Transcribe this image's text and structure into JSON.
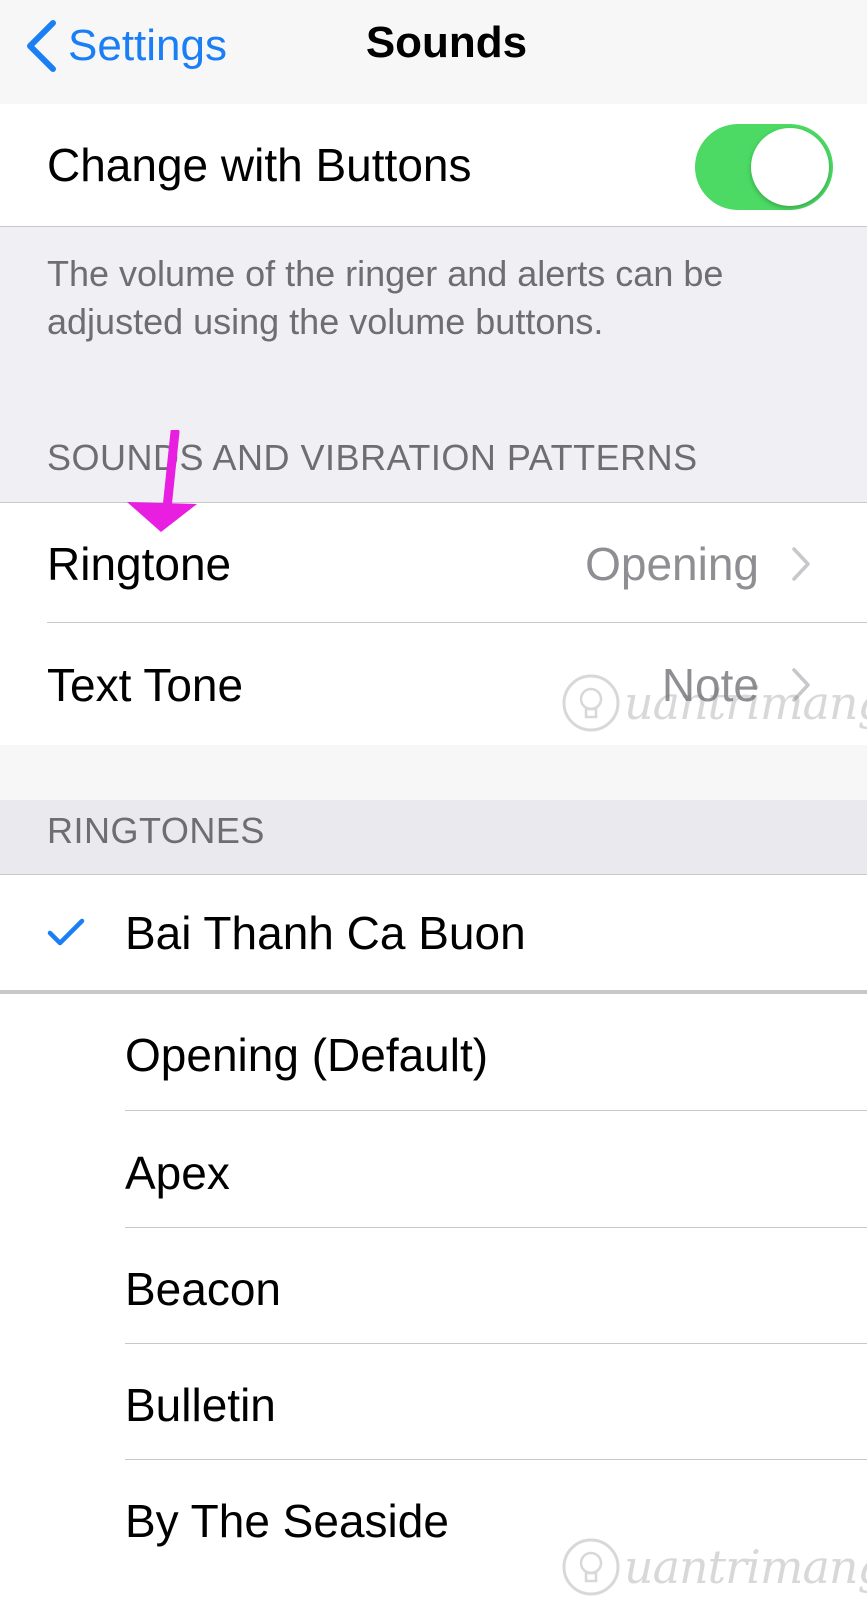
{
  "nav": {
    "back_label": "Settings",
    "title": "Sounds"
  },
  "change_with_buttons": {
    "label": "Change with Buttons",
    "on": true,
    "footer": "The volume of the ringer and alerts can be adjusted using the volume buttons."
  },
  "sounds_section": {
    "header": "SOUNDS AND VIBRATION PATTERNS",
    "rows": [
      {
        "label": "Ringtone",
        "value": "Opening"
      },
      {
        "label": "Text Tone",
        "value": "Note"
      }
    ]
  },
  "ringtones_section": {
    "header": "RINGTONES",
    "selected": "Bai Thanh Ca Buon",
    "items": [
      "Opening (Default)",
      "Apex",
      "Beacon",
      "Bulletin",
      "By The Seaside"
    ]
  },
  "watermark": {
    "text": "uantrimang",
    "icon": "lightbulb-icon"
  },
  "colors": {
    "accent": "#1a7ef5",
    "toggle_on": "#4cd964",
    "annotation_arrow": "#e81ee0"
  }
}
